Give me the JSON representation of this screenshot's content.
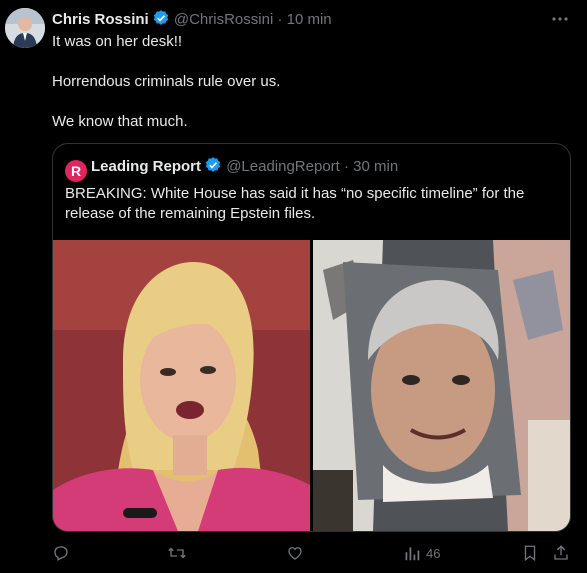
{
  "tweet": {
    "author_name": "Chris Rossini",
    "handle": "@ChrisRossini",
    "separator": "·",
    "time": "10 min",
    "lines": [
      "It was on her desk!!",
      "Horrendous criminals rule over us.",
      "We know that much."
    ]
  },
  "quote": {
    "logo_letter": "R",
    "author_name": "Leading Report",
    "handle": "@LeadingReport",
    "separator": "·",
    "time": "30 min",
    "text": "BREAKING: White House has said it has “no specific timeline” for the release of the remaining Epstein files."
  },
  "actions": {
    "reply_icon": "reply-icon",
    "retweet_icon": "retweet-icon",
    "like_icon": "heart-icon",
    "views_icon": "views-icon",
    "views_count": "46",
    "bookmark_icon": "bookmark-icon",
    "share_icon": "share-icon"
  },
  "colors": {
    "background": "#000000",
    "text": "#e7e9ea",
    "muted": "#71767b",
    "verified": "#1d9bf0",
    "border": "#2f3336",
    "logo": "#e0245e"
  }
}
